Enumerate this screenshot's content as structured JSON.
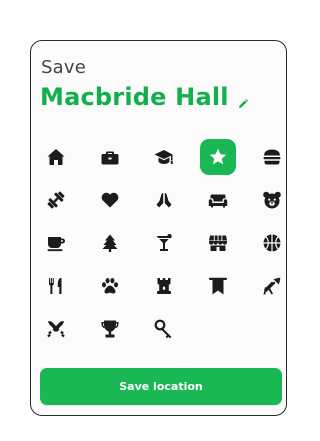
{
  "dialog": {
    "heading": "Save",
    "place_name": "Macbride Hall",
    "edit_icon": "pencil-icon",
    "button_label": "Save location"
  },
  "colors": {
    "accent": "#19b854",
    "title": "#12b04c",
    "icon": "#1c1c1c",
    "selected_icon": "#ffffff"
  },
  "icons": [
    {
      "name": "home-icon",
      "selected": false
    },
    {
      "name": "briefcase-icon",
      "selected": false
    },
    {
      "name": "graduation-cap-icon",
      "selected": false
    },
    {
      "name": "star-icon",
      "selected": true
    },
    {
      "name": "burger-icon",
      "selected": false
    },
    {
      "name": "dumbbell-icon",
      "selected": false
    },
    {
      "name": "heart-icon",
      "selected": false
    },
    {
      "name": "praying-hands-icon",
      "selected": false
    },
    {
      "name": "sofa-icon",
      "selected": false
    },
    {
      "name": "bear-icon",
      "selected": false
    },
    {
      "name": "coffee-cup-icon",
      "selected": false
    },
    {
      "name": "tree-icon",
      "selected": false
    },
    {
      "name": "cocktail-icon",
      "selected": false
    },
    {
      "name": "store-icon",
      "selected": false
    },
    {
      "name": "basketball-icon",
      "selected": false
    },
    {
      "name": "utensils-icon",
      "selected": false
    },
    {
      "name": "paw-icon",
      "selected": false
    },
    {
      "name": "castle-tower-icon",
      "selected": false
    },
    {
      "name": "banner-icon",
      "selected": false
    },
    {
      "name": "trumpet-icon",
      "selected": false
    },
    {
      "name": "crossed-swords-icon",
      "selected": false
    },
    {
      "name": "trophy-icon",
      "selected": false
    },
    {
      "name": "key-icon",
      "selected": false
    }
  ]
}
